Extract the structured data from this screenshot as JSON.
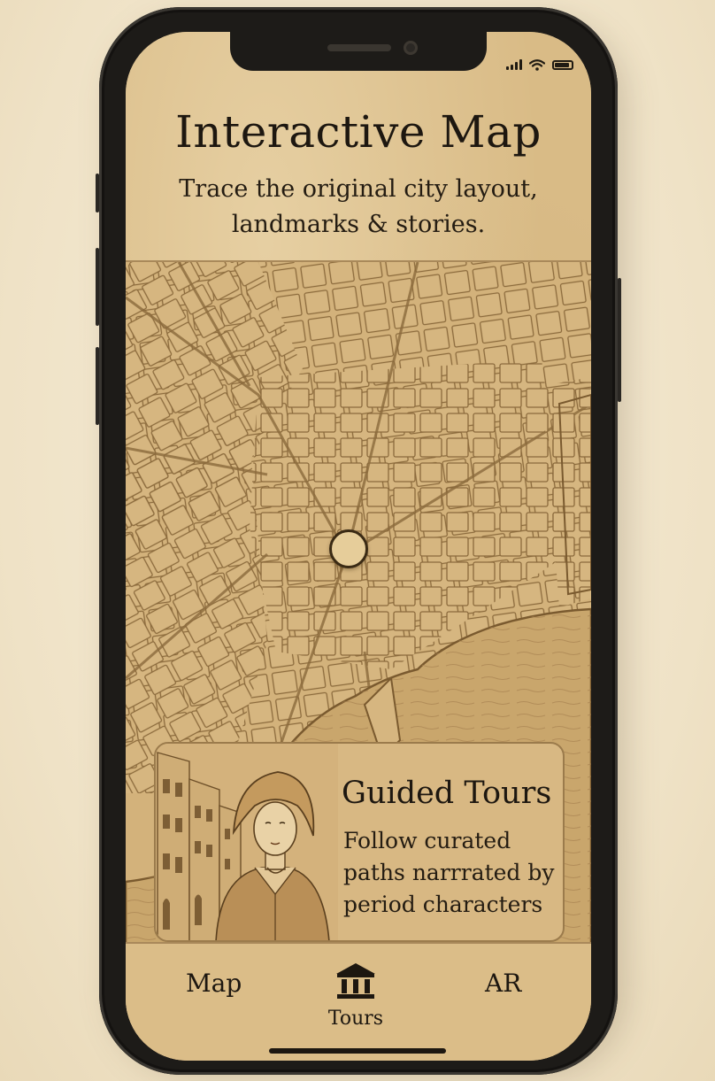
{
  "header": {
    "title": "Interactive Map",
    "subtitle_line1": "Trace the original city layout,",
    "subtitle_line2": "landmarks & stories."
  },
  "card": {
    "title": "Guided Tours",
    "line1": "Follow curated",
    "line2": "paths narrrated by",
    "line3": "period characters"
  },
  "tabbar": {
    "map": "Map",
    "tours": "Tours",
    "ar": "AR",
    "active": "Tours"
  },
  "colors": {
    "paper": "#d9bb86",
    "ink": "#1d1710",
    "line": "#9b7b4c"
  },
  "icons": {
    "tours": "museum-icon",
    "signal": "cell-signal-icon",
    "wifi": "wifi-icon",
    "battery": "battery-icon",
    "location": "location-pin-icon"
  }
}
